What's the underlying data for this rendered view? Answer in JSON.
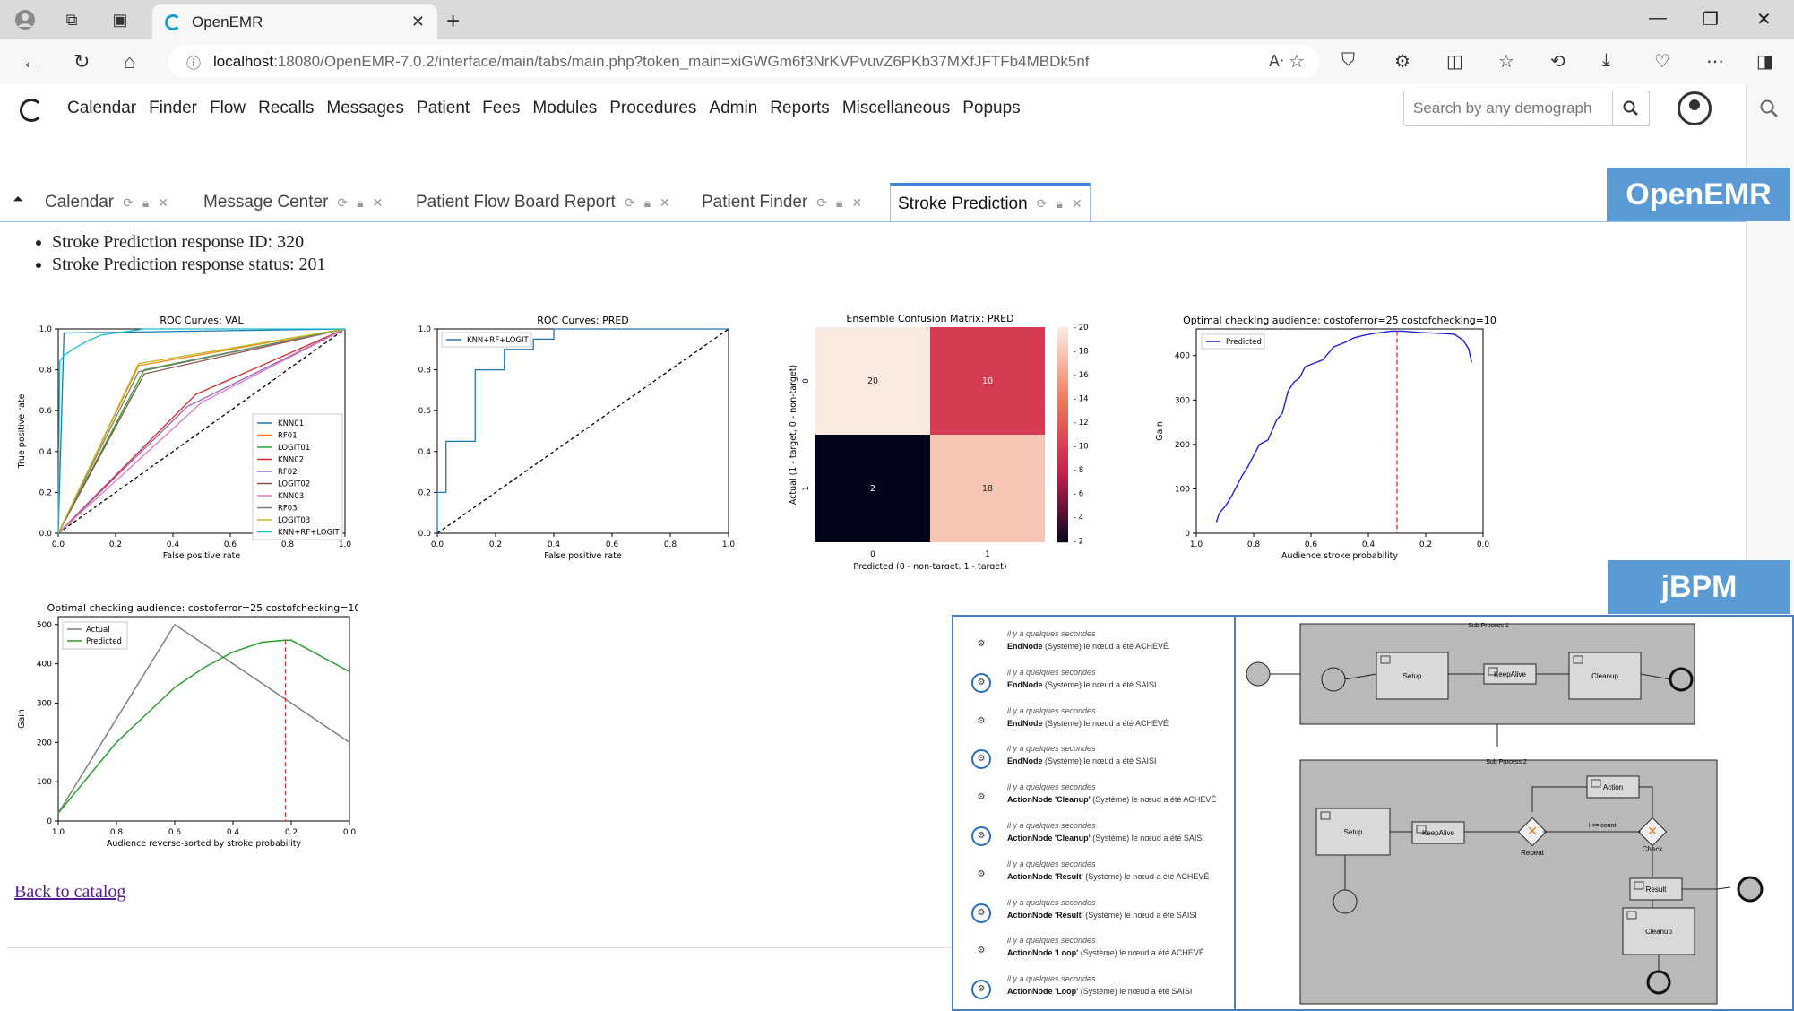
{
  "browser": {
    "tab_title": "OpenEMR",
    "url_host": "localhost",
    "url_rest": ":18080/OpenEMR-7.0.2/interface/main/tabs/main.php?token_main=xiGWGm6f3NrKVPvuvZ6PKb37MXfJFTFb4MBDk5nf"
  },
  "menu": [
    "Calendar",
    "Finder",
    "Flow",
    "Recalls",
    "Messages",
    "Patient",
    "Fees",
    "Modules",
    "Procedures",
    "Admin",
    "Reports",
    "Miscellaneous",
    "Popups"
  ],
  "search": {
    "placeholder": "Search by any demograph"
  },
  "tabs": [
    {
      "label": "Calendar"
    },
    {
      "label": "Message Center"
    },
    {
      "label": "Patient Flow Board Report"
    },
    {
      "label": "Patient Finder"
    },
    {
      "label": "Stroke Prediction"
    }
  ],
  "brands": {
    "openemr": "OpenEMR",
    "jbpm": "jBPM"
  },
  "bullets": [
    "Stroke Prediction response ID: 320",
    "Stroke Prediction response status: 201"
  ],
  "back_link": "Back to catalog",
  "chart_data": [
    {
      "type": "line",
      "title": "ROC Curves: VAL",
      "xlabel": "False positive rate",
      "ylabel": "True positive rate",
      "xlim": [
        0,
        1
      ],
      "ylim": [
        0,
        1
      ],
      "legend": "bottom-right",
      "series": [
        {
          "name": "KNN01",
          "color": "#1f77b4",
          "x": [
            0,
            0.02,
            1
          ],
          "y": [
            0,
            0.98,
            1
          ]
        },
        {
          "name": "RF01",
          "color": "#ff7f0e",
          "x": [
            0,
            0.28,
            1
          ],
          "y": [
            0,
            0.82,
            1
          ]
        },
        {
          "name": "LOGIT01",
          "color": "#2ca02c",
          "x": [
            0,
            0.3,
            1
          ],
          "y": [
            0,
            0.8,
            1
          ]
        },
        {
          "name": "KNN02",
          "color": "#d62728",
          "x": [
            0,
            0.48,
            1
          ],
          "y": [
            0,
            0.68,
            1
          ]
        },
        {
          "name": "RF02",
          "color": "#9467bd",
          "x": [
            0,
            0.45,
            1
          ],
          "y": [
            0,
            0.62,
            1
          ]
        },
        {
          "name": "LOGIT02",
          "color": "#8c564b",
          "x": [
            0,
            0.3,
            1
          ],
          "y": [
            0,
            0.78,
            1
          ]
        },
        {
          "name": "KNN03",
          "color": "#e377c2",
          "x": [
            0,
            0.5,
            1
          ],
          "y": [
            0,
            0.64,
            1
          ]
        },
        {
          "name": "RF03",
          "color": "#7f7f7f",
          "x": [
            0,
            0.28,
            1
          ],
          "y": [
            0,
            0.79,
            1
          ]
        },
        {
          "name": "LOGIT03",
          "color": "#bcbd22",
          "x": [
            0,
            0.28,
            1
          ],
          "y": [
            0,
            0.83,
            1
          ]
        },
        {
          "name": "KNN+RF+LOGIT",
          "color": "#17becf",
          "x": [
            0,
            0.005,
            0.02,
            0.05,
            0.1,
            0.15,
            0.2,
            0.3,
            1
          ],
          "y": [
            0,
            0.84,
            0.87,
            0.9,
            0.94,
            0.97,
            0.98,
            1,
            1
          ]
        }
      ]
    },
    {
      "type": "line",
      "title": "ROC Curves: PRED",
      "xlabel": "False positive rate",
      "legend": "top-left",
      "xlim": [
        0,
        1
      ],
      "ylim": [
        0,
        1
      ],
      "series": [
        {
          "name": "KNN+RF+LOGIT",
          "color": "#1f77b4",
          "x": [
            0,
            0,
            0.03,
            0.03,
            0.05,
            0.05,
            0.13,
            0.13,
            0.23,
            0.23,
            0.33,
            0.33,
            0.4,
            0.4,
            0.6,
            0.6,
            1
          ],
          "y": [
            0,
            0.2,
            0.2,
            0.45,
            0.45,
            0.45,
            0.45,
            0.8,
            0.8,
            0.9,
            0.9,
            0.95,
            0.95,
            1,
            1,
            1,
            1
          ]
        }
      ]
    },
    {
      "type": "heatmap",
      "title": "Ensemble Confusion Matrix: PRED",
      "xlabel": "Predicted (0 - non-target, 1 - target)",
      "ylabel": "Actual (1 - target, 0 - non-target)",
      "x_ticks": [
        "0",
        "1"
      ],
      "y_ticks": [
        "0",
        "1"
      ],
      "values": [
        [
          20,
          10
        ],
        [
          2,
          18
        ]
      ],
      "colorbar": [
        "20",
        "18",
        "16",
        "14",
        "12",
        "10",
        "8",
        "6",
        "4",
        "2"
      ]
    },
    {
      "type": "line",
      "title": "Optimal checking audience: costoferror=25 costofchecking=10",
      "xlabel": "Audience stroke probability",
      "ylabel": "Gain",
      "legend": "top-left",
      "xlim": [
        1.0,
        0.0
      ],
      "ylim": [
        0,
        460
      ],
      "series": [
        {
          "name": "Predicted",
          "color": "#1f1fdd",
          "x": [
            0.93,
            0.92,
            0.9,
            0.88,
            0.86,
            0.84,
            0.82,
            0.8,
            0.78,
            0.75,
            0.72,
            0.7,
            0.68,
            0.66,
            0.64,
            0.62,
            0.6,
            0.56,
            0.52,
            0.5,
            0.48,
            0.45,
            0.42,
            0.38,
            0.32,
            0.28,
            0.22,
            0.15,
            0.1,
            0.07,
            0.05,
            0.04
          ],
          "y": [
            25,
            45,
            60,
            80,
            105,
            130,
            150,
            175,
            200,
            210,
            255,
            270,
            320,
            340,
            350,
            375,
            380,
            390,
            420,
            425,
            430,
            440,
            445,
            450,
            455,
            455,
            452,
            450,
            448,
            435,
            415,
            385
          ]
        }
      ],
      "vline": 0.3
    },
    {
      "type": "line",
      "title": "Optimal checking audience: costoferror=25 costofchecking=10",
      "xlabel": "Audience reverse-sorted by stroke probability",
      "ylabel": "Gain",
      "legend": "top-left",
      "xlim": [
        1.0,
        0.0
      ],
      "ylim": [
        0,
        520
      ],
      "series": [
        {
          "name": "Actual",
          "color": "#808080",
          "x": [
            1.0,
            0.6,
            0.0
          ],
          "y": [
            20,
            500,
            200
          ]
        },
        {
          "name": "Predicted",
          "color": "#2ca02c",
          "x": [
            1.0,
            0.9,
            0.8,
            0.7,
            0.6,
            0.5,
            0.4,
            0.3,
            0.22,
            0.2,
            0.1,
            0.0
          ],
          "y": [
            20,
            110,
            200,
            270,
            340,
            390,
            430,
            455,
            460,
            460,
            420,
            380
          ]
        }
      ],
      "vline": 0.22
    }
  ],
  "jbpm_log": [
    {
      "time": "il y a quelques secondes",
      "node": "EndNode",
      "rest": "(Système) le nœud a été ACHEVÉ",
      "icon": "gear"
    },
    {
      "time": "il y a quelques secondes",
      "node": "EndNode",
      "rest": "(Système) le nœud a été SAISI",
      "icon": "gear-circle"
    },
    {
      "time": "il y a quelques secondes",
      "node": "EndNode",
      "rest": "(Système) le nœud a été ACHEVÉ",
      "icon": "gear"
    },
    {
      "time": "il y a quelques secondes",
      "node": "EndNode",
      "rest": "(Système) le nœud a été SAISI",
      "icon": "gear-circle"
    },
    {
      "time": "il y a quelques secondes",
      "node": "ActionNode 'Cleanup'",
      "rest": "(Système) le nœud a été ACHEVÉ",
      "icon": "gear"
    },
    {
      "time": "il y a quelques secondes",
      "node": "ActionNode 'Cleanup'",
      "rest": "(Système) le nœud a été SAISI",
      "icon": "gear-circle"
    },
    {
      "time": "il y a quelques secondes",
      "node": "ActionNode 'Result'",
      "rest": "(Système) le nœud a été ACHEVÉ",
      "icon": "gear"
    },
    {
      "time": "il y a quelques secondes",
      "node": "ActionNode 'Result'",
      "rest": "(Système) le nœud a été SAISI",
      "icon": "gear-circle"
    },
    {
      "time": "il y a quelques secondes",
      "node": "ActionNode 'Loop'",
      "rest": "(Système) le nœud a été ACHEVÉ",
      "icon": "gear"
    },
    {
      "time": "il y a quelques secondes",
      "node": "ActionNode 'Loop'",
      "rest": "(Système) le nœud a été SAISI",
      "icon": "gear-circle"
    }
  ],
  "diagram": {
    "sub1_label": "Sub Process 1",
    "sub2_label": "Sub Process 2",
    "setup": "Setup",
    "keepalive": "KeepAlive",
    "cleanup": "Cleanup",
    "action": "Action",
    "repeat": "Repeat",
    "check": "Check",
    "count_cond": "i <= count",
    "result": "Result"
  }
}
